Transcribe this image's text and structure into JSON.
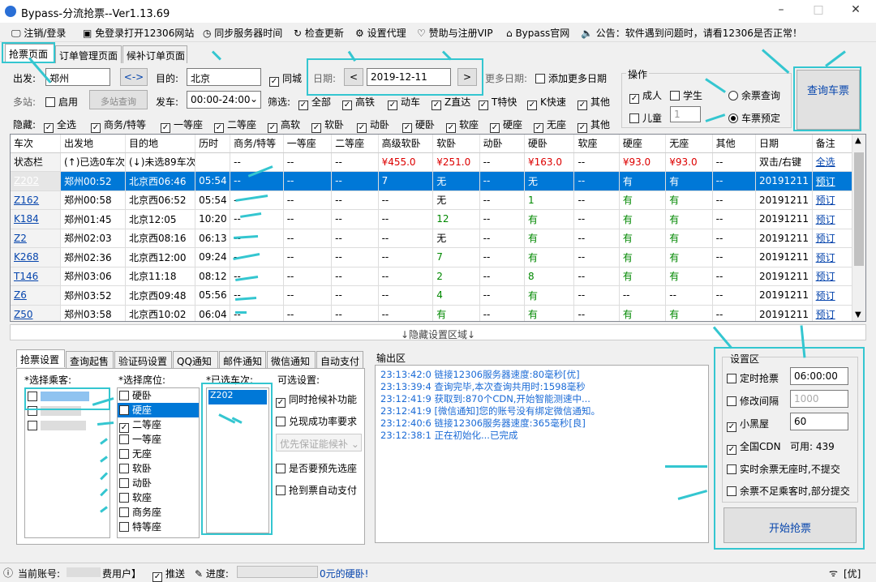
{
  "window": {
    "title": "Bypass-分流抢票--Ver1.13.69",
    "min": "–",
    "max": "□",
    "close": "✕"
  },
  "menu": [
    {
      "label": "注销/登录",
      "icon": "monitor-icon"
    },
    {
      "label": "免登录打开12306网站",
      "icon": "window-icon"
    },
    {
      "label": "同步服务器时间",
      "icon": "clock-icon"
    },
    {
      "label": "检查更新",
      "icon": "refresh-icon"
    },
    {
      "label": "设置代理",
      "icon": "gear-icon"
    },
    {
      "label": "赞助与注册VIP",
      "icon": "heart-icon"
    },
    {
      "label": "Bypass官网",
      "icon": "home-icon"
    },
    {
      "label": "公告：软件遇到问题时，请看12306是否正常！",
      "icon": "speaker-icon"
    }
  ],
  "tabs": [
    "抢票页面",
    "订单管理页面",
    "候补订单页面"
  ],
  "search": {
    "from_label": "出发:",
    "from": "郑州",
    "swap": "<->",
    "to_label": "目的:",
    "to": "北京",
    "same_city": "同城",
    "date_label": "日期:",
    "date": "2019-12-11",
    "prev": "<",
    "next": ">",
    "more_dates_label": "更多日期:",
    "add_more_dates": "添加更多日期",
    "multi_label": "多站:",
    "enable": "启用",
    "multi_query": "多站查询",
    "depart_label": "发车:",
    "depart_time": "00:00-24:00",
    "filter_label": "筛选:",
    "filters": [
      "全部",
      "高铁",
      "动车",
      "Z直达",
      "T特快",
      "K快速",
      "其他"
    ],
    "hide_label": "隐藏:",
    "hides": [
      "全选",
      "商务/特等",
      "一等座",
      "二等座",
      "高软",
      "软卧",
      "动卧",
      "硬卧",
      "软座",
      "硬座",
      "无座",
      "其他"
    ],
    "ops_label": "操作",
    "adult": "成人",
    "student": "学生",
    "child": "儿童",
    "child_count": "1",
    "remain_query": "余票查询",
    "book": "车票预定",
    "query_btn": "查询车票"
  },
  "grid": {
    "columns": [
      "车次",
      "出发地",
      "目的地",
      "历时",
      "商务/特等",
      "一等座",
      "二等座",
      "高级软卧",
      "软卧",
      "动卧",
      "硬卧",
      "软座",
      "硬座",
      "无座",
      "其他",
      "日期",
      "备注"
    ],
    "status_row": [
      "状态栏",
      "(↑)已选0车次",
      "(↓)未选89车次",
      "",
      "--",
      "--",
      "--",
      "¥455.0",
      "¥251.0",
      "--",
      "¥163.0",
      "--",
      "¥93.0",
      "¥93.0",
      "--",
      "双击/右键",
      "全选"
    ],
    "rows": [
      [
        "Z202",
        "郑州00:52",
        "北京西06:46",
        "05:54",
        "--",
        "--",
        "--",
        "7",
        "无",
        "--",
        "无",
        "--",
        "有",
        "有",
        "--",
        "20191211",
        "预订"
      ],
      [
        "Z162",
        "郑州00:58",
        "北京西06:52",
        "05:54",
        "--",
        "--",
        "--",
        "--",
        "无",
        "--",
        "1",
        "--",
        "有",
        "有",
        "--",
        "20191211",
        "预订"
      ],
      [
        "K184",
        "郑州01:45",
        "北京12:05",
        "10:20",
        "--",
        "--",
        "--",
        "--",
        "12",
        "--",
        "有",
        "--",
        "有",
        "有",
        "--",
        "20191211",
        "预订"
      ],
      [
        "Z2",
        "郑州02:03",
        "北京西08:16",
        "06:13",
        "--",
        "--",
        "--",
        "--",
        "无",
        "--",
        "有",
        "--",
        "有",
        "有",
        "--",
        "20191211",
        "预订"
      ],
      [
        "K268",
        "郑州02:36",
        "北京西12:00",
        "09:24",
        "--",
        "--",
        "--",
        "--",
        "7",
        "--",
        "有",
        "--",
        "有",
        "有",
        "--",
        "20191211",
        "预订"
      ],
      [
        "T146",
        "郑州03:06",
        "北京11:18",
        "08:12",
        "--",
        "--",
        "--",
        "--",
        "2",
        "--",
        "8",
        "--",
        "有",
        "有",
        "--",
        "20191211",
        "预订"
      ],
      [
        "Z6",
        "郑州03:52",
        "北京西09:48",
        "05:56",
        "--",
        "--",
        "--",
        "--",
        "4",
        "--",
        "有",
        "--",
        "--",
        "--",
        "--",
        "20191211",
        "预订"
      ],
      [
        "Z50",
        "郑州03:58",
        "北京西10:02",
        "06:04",
        "--",
        "--",
        "--",
        "--",
        "有",
        "--",
        "有",
        "--",
        "有",
        "有",
        "--",
        "20191211",
        "预订"
      ]
    ],
    "hidden_area": "↓隐藏设置区域↓"
  },
  "settings_tabs": [
    "抢票设置",
    "查询起售",
    "验证码设置",
    "QQ通知",
    "邮件通知",
    "微信通知",
    "自动支付"
  ],
  "settings": {
    "passengers_label": "*选择乘客:",
    "seats_label": "*选择席位:",
    "seats": [
      {
        "label": "硬卧",
        "checked": false
      },
      {
        "label": "硬座",
        "checked": false,
        "selected": true
      },
      {
        "label": "二等座",
        "checked": true
      },
      {
        "label": "一等座",
        "checked": false
      },
      {
        "label": "无座",
        "checked": false
      },
      {
        "label": "软卧",
        "checked": false
      },
      {
        "label": "动卧",
        "checked": false
      },
      {
        "label": "软座",
        "checked": false
      },
      {
        "label": "商务座",
        "checked": false
      },
      {
        "label": "特等座",
        "checked": false
      }
    ],
    "trains_label": "*已选车次:",
    "trains": [
      "Z202"
    ],
    "optional_label": "可选设置:",
    "opt_waitlist": "同时抢候补功能",
    "opt_rate": "兑现成功率要求",
    "opt_priority": "优先保证能候补",
    "opt_preselect": "是否要预先选座",
    "opt_autopay": "抢到票自动支付"
  },
  "output": {
    "label": "输出区",
    "lines": [
      "23:13:42:0  链接12306服务器速度:80毫秒[优]",
      "23:13:39:4  查询完毕,本次查询共用时:1598毫秒",
      "23:12:41:9  获取到:870个CDN,开始智能测速中...",
      "23:12:41:9  [微信通知]您的账号没有绑定微信通知。",
      "23:12:40:6  链接12306服务器速度:365毫秒[良]",
      "23:12:38:1  正在初始化...已完成"
    ]
  },
  "config": {
    "label": "设置区",
    "timed": "定时抢票",
    "timed_value": "06:00:00",
    "interval": "修改间隔",
    "interval_value": "1000",
    "blackroom": "小黑屋",
    "blackroom_value": "60",
    "cdn": "全国CDN",
    "cdn_avail": "可用: 439",
    "no_submit": "实时余票无座时,不提交",
    "partial": "余票不足乘客时,部分提交",
    "start": "开始抢票"
  },
  "status": {
    "account": "当前账号:",
    "user_type": "费用户】",
    "push": "推送",
    "progress": "进度:",
    "msg": "0元的硬卧!",
    "net": "[优]"
  },
  "colors": {
    "accent": "#34c6d0",
    "select": "#0078d7",
    "price": "#d00000",
    "avail": "#008000"
  }
}
